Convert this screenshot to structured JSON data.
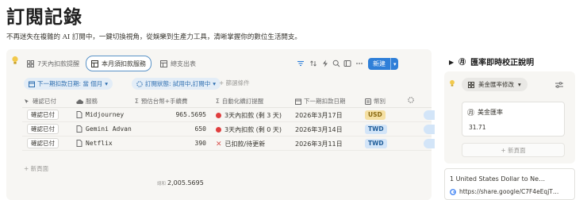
{
  "page": {
    "title": "訂閱記錄",
    "subtitle": "不再迷失在複雜的 AI 訂閱中，一鍵切換視角，從娛樂到生產力工具，清晰掌握你的數位生活開支。"
  },
  "views": [
    {
      "label": "7天內扣款提醒"
    },
    {
      "label": "本月須扣款服務"
    },
    {
      "label": "總支出表"
    }
  ],
  "toolbar": {
    "new_label": "新建"
  },
  "filters": [
    {
      "label": "下一期扣款日期: 當 個月"
    },
    {
      "label": "訂閱狀態: 試用中,訂閱中"
    }
  ],
  "add_filter_label": "+ 篩選條件",
  "table": {
    "headers": [
      "確認已付",
      "服務",
      "預估台幣+手續費",
      "自動化續訂提醒",
      "下一期扣款日期",
      "幣別",
      ""
    ],
    "rows": [
      {
        "confirm": "確認已付",
        "service": "Midjourney",
        "amount": "965.5695",
        "reminder": "3天內扣款 (剩 3 天)",
        "date": "2026年3月17日",
        "currency": "USD",
        "indicator": "red-dot"
      },
      {
        "confirm": "確認已付",
        "service": "Gemini Advan",
        "amount": "650",
        "reminder": "3天內扣款 (剩 0 天)",
        "date": "2026年3月14日",
        "currency": "TWD",
        "indicator": "red-dot"
      },
      {
        "confirm": "確認已付",
        "service": "Netflix",
        "amount": "390",
        "reminder": "已扣款/待更新",
        "date": "2026年3月11日",
        "currency": "TWD",
        "indicator": "x-mark"
      }
    ],
    "new_page_label": "+ 新頁面",
    "sum_label": "總和",
    "sum_value": "2,005.5695"
  },
  "colors": {
    "usd_tag": "#f5e0a3",
    "twd_tag": "#d3e5f8",
    "accent": "#2f7fd8"
  },
  "right": {
    "heading": "匯率即時校正說明",
    "view_label": "美金匯率修改",
    "card_title": "美金匯率",
    "card_value": "31.71",
    "new_page_label": "+ 新頁面",
    "bookmark_title": "1 United States Dollar to Ne…",
    "bookmark_url": "https://share.google/C7F4eEqjT…"
  }
}
